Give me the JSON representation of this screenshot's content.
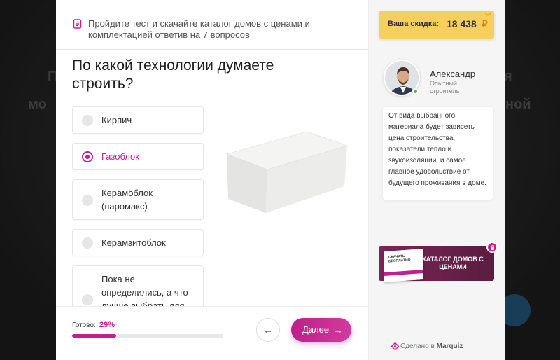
{
  "background": {
    "text_left_1": "П",
    "text_left_2": "мо",
    "text_right_1": "я",
    "text_right_2": "ной"
  },
  "header": {
    "icon": "document-list-icon",
    "text": "Пройдите тест и скачайте каталог домов с ценами и комплектацией ответив на 7 вопросов"
  },
  "question": {
    "title": "По какой технологии думаете строить?"
  },
  "options": [
    {
      "label": "Кирпич",
      "selected": false
    },
    {
      "label": "Газоблок",
      "selected": true
    },
    {
      "label": "Керамоблок (паромакс)",
      "selected": false
    },
    {
      "label": "Керамзитоблок",
      "selected": false
    },
    {
      "label": "Пока не определились, а что лучше выбрать для",
      "selected": false
    }
  ],
  "footer": {
    "progress_label": "Готово:",
    "progress_value": "29%",
    "progress_fraction": 0.29,
    "back_icon": "arrow-left-icon",
    "next_label": "Далее",
    "next_icon": "arrow-right-icon"
  },
  "discount": {
    "label": "Ваша скидка:",
    "value": "18 438",
    "currency": "₽",
    "icon": "chevron-double-down-icon"
  },
  "consultant": {
    "name": "Александр",
    "role": "Опытный строитель",
    "message": "От вида выбранного материала будет зависеть цена строительства, показатели тепло и звукоизоляции, и самое главное удовольствие от будущего проживания в доме."
  },
  "catalog": {
    "label": "КАТАЛОГ ДОМОВ С ЦЕНАМИ",
    "book_title": "СКАЧАТЬ БЕСПЛАТНО",
    "lock_icon": "lock-icon"
  },
  "branding": {
    "made_with": "Сделано в",
    "brand": "Marquiz"
  },
  "colors": {
    "accent": "#c3208f",
    "discount_bg": "#f7cf61",
    "catalog_bg": "#6b1f4b",
    "online": "#3bbd4a"
  }
}
